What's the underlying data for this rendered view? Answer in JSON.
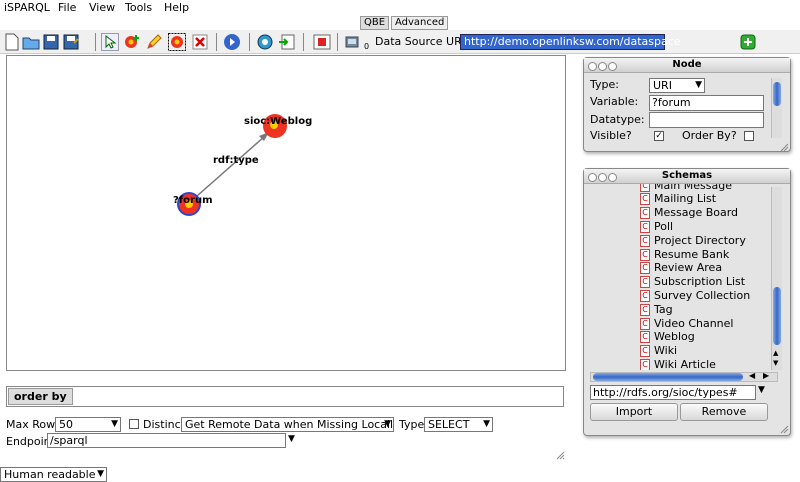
{
  "menu": {
    "app": "iSPARQL",
    "items": [
      "File",
      "View",
      "Tools",
      "Help"
    ]
  },
  "tabs": [
    "QBE",
    "Advanced"
  ],
  "toolbar": {
    "datasource_label": "Data Source URI",
    "datasource_value": "http://demo.openlinksw.com/dataspace"
  },
  "canvas": {
    "nodes": [
      {
        "label": "sioc:Weblog"
      },
      {
        "label": "?forum"
      }
    ],
    "edge_label": "rdf:type"
  },
  "orderby": {
    "label": "order by"
  },
  "controls": {
    "max_rows_label": "Max Rows",
    "max_rows_value": "50",
    "distinct_label": "Distinct",
    "remote_value": "Get Remote Data when Missing Locally",
    "type_label": "Type",
    "type_value": "SELECT",
    "endpoint_label": "Endpoint",
    "endpoint_value": "/sparql",
    "format_value": "Human readable"
  },
  "node_panel": {
    "title": "Node",
    "type_label": "Type:",
    "type_value": "URI",
    "variable_label": "Variable:",
    "variable_value": "?forum",
    "datatype_label": "Datatype:",
    "datatype_value": "",
    "visible_label": "Visible?",
    "orderby_label": "Order By?"
  },
  "schemas_panel": {
    "title": "Schemas",
    "items": [
      "Main Message",
      "Mailing List",
      "Message Board",
      "Poll",
      "Project Directory",
      "Resume Bank",
      "Review Area",
      "Subscription List",
      "Survey Collection",
      "Tag",
      "Video Channel",
      "Weblog",
      "Wiki",
      "Wiki Article"
    ],
    "uri_value": "http://rdfs.org/sioc/types#",
    "import_label": "Import",
    "remove_label": "Remove"
  }
}
